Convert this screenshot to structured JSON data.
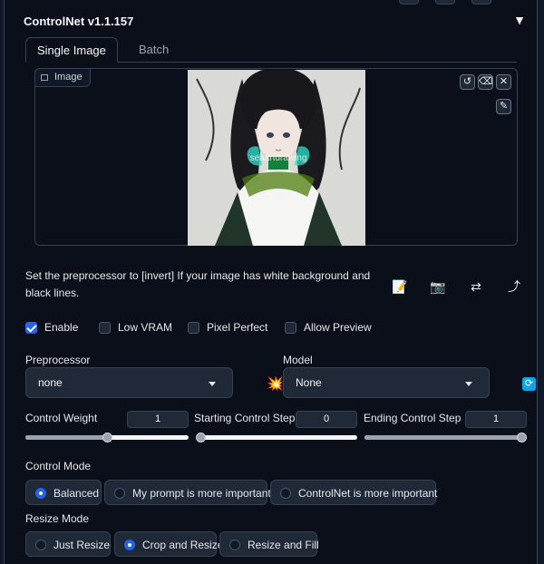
{
  "accordion": {
    "title": "ControlNet v1.1.157",
    "toggle_glyph": "▼"
  },
  "tabs": [
    {
      "label": "Single Image",
      "active": true
    },
    {
      "label": "Batch",
      "active": false
    }
  ],
  "image": {
    "label": "Image",
    "watermark": "seaartdrawing",
    "tools": {
      "reset": "↺",
      "eraser": "⌫",
      "close": "✕",
      "brush": "✎"
    }
  },
  "hint_text": "Set the preprocessor to [invert] If your image has white background and black lines.",
  "action_icons": {
    "new_canvas": "📝",
    "webcam": "📷",
    "swap": "⇄",
    "send": "⤴"
  },
  "checkboxes": [
    {
      "label": "Enable",
      "checked": true
    },
    {
      "label": "Low VRAM",
      "checked": false
    },
    {
      "label": "Pixel Perfect",
      "checked": false
    },
    {
      "label": "Allow Preview",
      "checked": false
    }
  ],
  "preprocessor": {
    "label": "Preprocessor",
    "value": "none"
  },
  "model": {
    "label": "Model",
    "value": "None"
  },
  "run_icon": "💥",
  "refresh_icon": "⟳",
  "sliders": [
    {
      "label": "Control Weight",
      "value": "1",
      "fraction": 0.5
    },
    {
      "label": "Starting Control Step",
      "value": "0",
      "fraction": 0.0
    },
    {
      "label": "Ending Control Step",
      "value": "1",
      "fraction": 1.0
    }
  ],
  "control_mode": {
    "label": "Control Mode",
    "options": [
      {
        "label": "Balanced",
        "selected": true
      },
      {
        "label": "My prompt is more important",
        "selected": false
      },
      {
        "label": "ControlNet is more important",
        "selected": false
      }
    ]
  },
  "resize_mode": {
    "label": "Resize Mode",
    "options": [
      {
        "label": "Just Resize",
        "selected": false
      },
      {
        "label": "Crop and Resize",
        "selected": true
      },
      {
        "label": "Resize and Fill",
        "selected": false
      }
    ]
  },
  "colors": {
    "background": "#0b0f19",
    "panel": "#1f2937",
    "border": "#374151",
    "accent": "#2563eb",
    "refresh": "#0ea5e9"
  }
}
